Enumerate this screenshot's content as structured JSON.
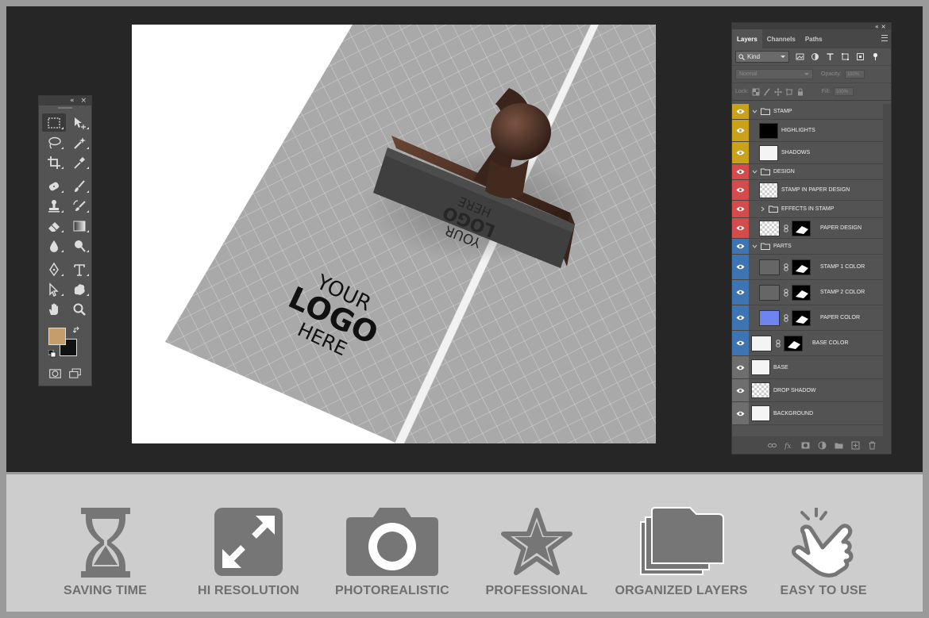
{
  "tools_panel": {
    "collapse_glyph": "«",
    "close_glyph": "×",
    "tools": [
      {
        "name": "rectangular-marquee-icon",
        "selected": true
      },
      {
        "name": "move-icon"
      },
      {
        "name": "lasso-icon"
      },
      {
        "name": "magic-wand-icon"
      },
      {
        "name": "crop-icon"
      },
      {
        "name": "eyedropper-icon"
      },
      {
        "name": "healing-brush-icon"
      },
      {
        "name": "brush-icon"
      },
      {
        "name": "clone-stamp-icon"
      },
      {
        "name": "history-brush-icon"
      },
      {
        "name": "eraser-icon"
      },
      {
        "name": "gradient-icon"
      },
      {
        "name": "blur-icon"
      },
      {
        "name": "dodge-icon"
      },
      {
        "name": "pen-icon"
      },
      {
        "name": "type-icon"
      },
      {
        "name": "path-selection-icon"
      },
      {
        "name": "custom-shape-icon"
      },
      {
        "name": "hand-icon"
      },
      {
        "name": "zoom-icon"
      }
    ],
    "foreground_color": "#c49d6a",
    "background_color": "#111111"
  },
  "canvas": {
    "logo_text": {
      "line1": "YOUR",
      "line2": "LOGO",
      "line3": "HERE"
    },
    "stamp_text": {
      "line1": "YOUR",
      "line2": "LOGO",
      "line3": "HERE"
    }
  },
  "layers_panel": {
    "top_controls": "«  ×",
    "tabs": [
      "Layers",
      "Channels",
      "Paths"
    ],
    "active_tab": "Layers",
    "filter_kind": "Kind",
    "blend_mode": "Normal",
    "opacity_label": "Opacity:",
    "opacity_value": "100%",
    "lock_label": "Lock:",
    "fill_label": "Fill:",
    "fill_value": "100%",
    "layers": [
      {
        "name": "STAMP",
        "type": "group",
        "label_color": "#c9a21a",
        "indent": 0
      },
      {
        "name": "HIGHLIGHTS",
        "type": "layer",
        "label_color": "#c9a21a",
        "indent": 1,
        "thumb": "black"
      },
      {
        "name": "SHADOWS",
        "type": "layer",
        "label_color": "#c9a21a",
        "indent": 1,
        "thumb": "white"
      },
      {
        "name": "DESIGN",
        "type": "group",
        "label_color": "#d54a4a",
        "indent": 0
      },
      {
        "name": "STAMP IN PAPER DESIGN",
        "type": "layer",
        "label_color": "#d54a4a",
        "indent": 1,
        "thumb": "checker"
      },
      {
        "name": "EFFECTS IN STAMP",
        "type": "group-collapsed",
        "label_color": "#d54a4a",
        "indent": 1
      },
      {
        "name": "PAPER DESIGN",
        "type": "layer-mask",
        "label_color": "#d54a4a",
        "indent": 1,
        "thumb": "checker"
      },
      {
        "name": "PARTS",
        "type": "group",
        "label_color": "#3d74b4",
        "indent": 0
      },
      {
        "name": "STAMP 1 COLOR",
        "type": "layer-mask",
        "label_color": "#3d74b4",
        "indent": 1,
        "thumb": "gray"
      },
      {
        "name": "STAMP 2 COLOR",
        "type": "layer-mask",
        "label_color": "#3d74b4",
        "indent": 1,
        "thumb": "gray"
      },
      {
        "name": "PAPER COLOR",
        "type": "layer-mask",
        "label_color": "#3d74b4",
        "indent": 1,
        "thumb": "blue"
      },
      {
        "name": "BASE COLOR",
        "type": "layer-mask",
        "label_color": "#3d74b4",
        "indent": 0,
        "thumb": "white"
      },
      {
        "name": "BASE",
        "type": "layer",
        "label_color": "#6e6e6e",
        "indent": 0,
        "thumb": "white"
      },
      {
        "name": "DROP SHADOW",
        "type": "layer",
        "label_color": "#6e6e6e",
        "indent": 0,
        "thumb": "checker"
      },
      {
        "name": "BACKGROUND",
        "type": "layer",
        "label_color": "#6e6e6e",
        "indent": 0,
        "thumb": "white"
      }
    ],
    "footer_icons": [
      "link-layers-icon",
      "fx-icon",
      "add-mask-icon",
      "adjustment-layer-icon",
      "new-group-icon",
      "new-layer-icon",
      "trash-icon"
    ]
  },
  "features": [
    {
      "label": "SAVING TIME",
      "icon": "hourglass-icon"
    },
    {
      "label": "HI RESOLUTION",
      "icon": "expand-icon"
    },
    {
      "label": "PHOTOREALISTIC",
      "icon": "camera-icon"
    },
    {
      "label": "PROFESSIONAL",
      "icon": "star-icon"
    },
    {
      "label": "ORGANIZED LAYERS",
      "icon": "folders-icon"
    },
    {
      "label": "EASY TO USE",
      "icon": "tap-hand-icon"
    }
  ],
  "colors": {
    "workspace": "#262626",
    "panel": "#535353",
    "feature_band": "#cdcdcd",
    "feature_icon": "#767676",
    "feature_text": "#6f6f6f"
  }
}
